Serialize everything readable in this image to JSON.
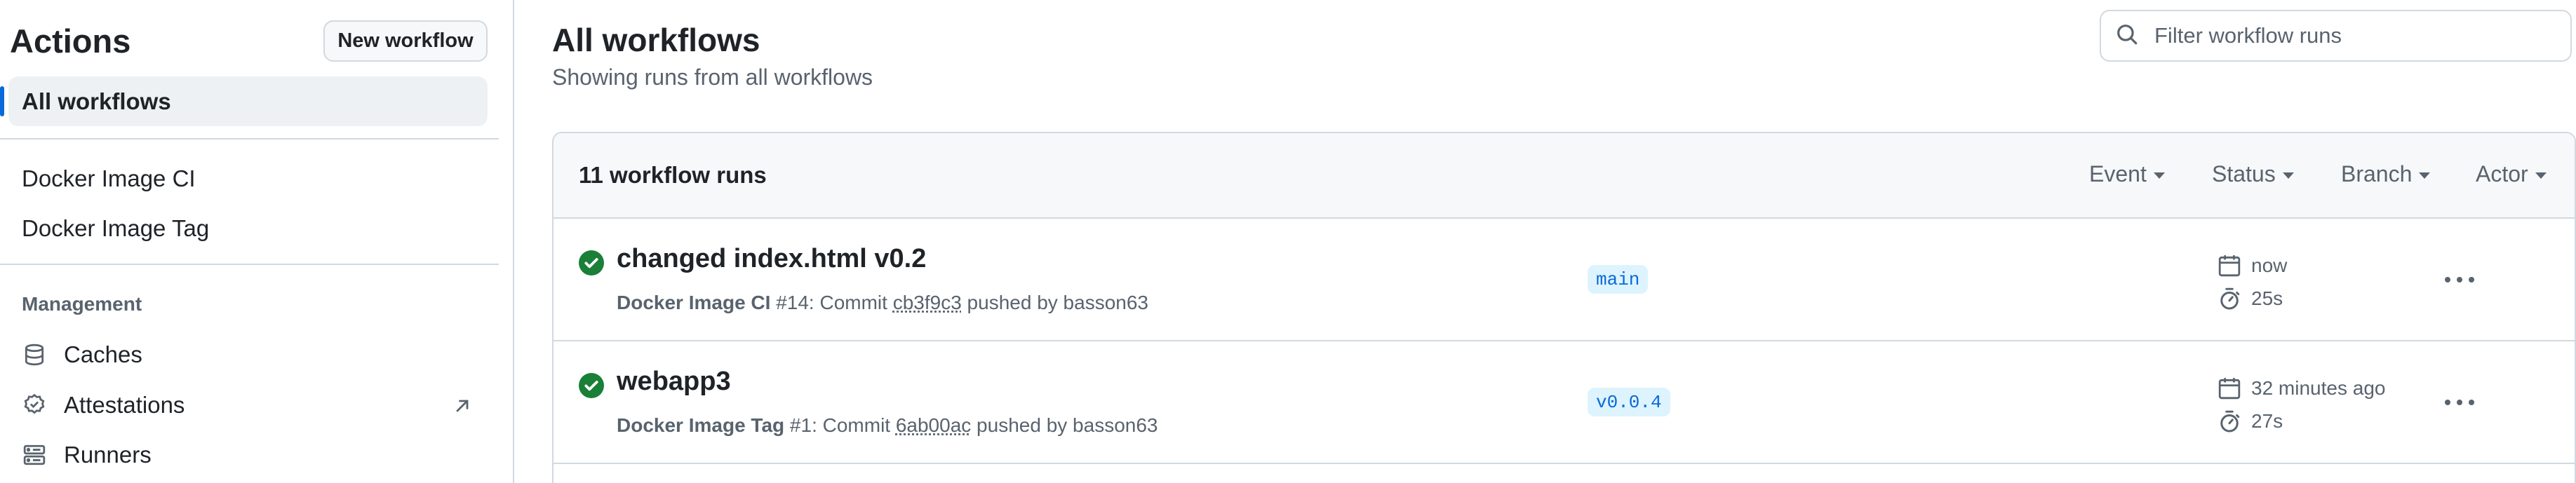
{
  "sidebar": {
    "title": "Actions",
    "new_workflow_label": "New workflow",
    "all_workflows_label": "All workflows",
    "workflows": [
      {
        "label": "Docker Image CI"
      },
      {
        "label": "Docker Image Tag"
      }
    ],
    "management_heading": "Management",
    "management_items": [
      {
        "label": "Caches",
        "icon": "database-icon"
      },
      {
        "label": "Attestations",
        "icon": "verified-icon",
        "external": true
      },
      {
        "label": "Runners",
        "icon": "server-icon"
      }
    ]
  },
  "main": {
    "title": "All workflows",
    "subtitle": "Showing runs from all workflows",
    "filter_placeholder": "Filter workflow runs",
    "runs_count": "11 workflow runs",
    "filters": [
      "Event",
      "Status",
      "Branch",
      "Actor"
    ],
    "runs": [
      {
        "title": "changed index.html v0.2",
        "workflow": "Docker Image CI",
        "number": "#14",
        "commit_prefix": ": Commit ",
        "sha": "cb3f9c3",
        "pushed_by": " pushed by basson63",
        "branch": "main",
        "time": "now",
        "duration": "25s",
        "status": "success"
      },
      {
        "title": "webapp3",
        "workflow": "Docker Image Tag",
        "number": "#1",
        "commit_prefix": ": Commit ",
        "sha": "6ab00ac",
        "pushed_by": " pushed by basson63",
        "branch": "v0.0.4",
        "time": "32 minutes ago",
        "duration": "27s",
        "status": "success"
      }
    ]
  },
  "colors": {
    "accent": "#0969da",
    "success": "#1a7f37",
    "muted": "#59636e",
    "border": "#d1d9e0",
    "branch_bg": "#ddf4ff"
  }
}
